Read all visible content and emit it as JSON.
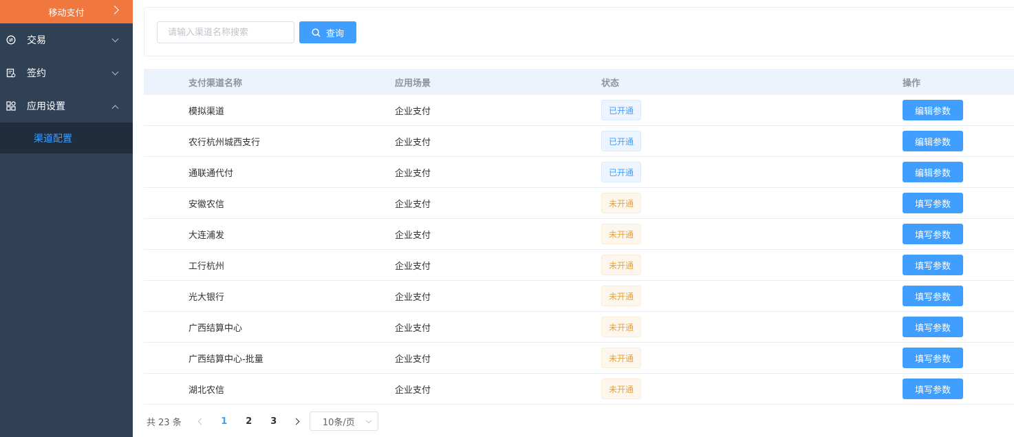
{
  "sidebar": {
    "top_label": "移动支付",
    "menu": [
      {
        "label": "交易",
        "icon": "transaction-icon",
        "expanded": false
      },
      {
        "label": "签约",
        "icon": "contract-icon",
        "expanded": false
      },
      {
        "label": "应用设置",
        "icon": "apps-grid-icon",
        "expanded": true
      }
    ],
    "submenu_active": "渠道配置"
  },
  "search": {
    "placeholder": "请输入渠道名称搜索",
    "value": "",
    "button_label": "查询"
  },
  "table": {
    "columns": [
      "支付渠道名称",
      "应用场景",
      "状态",
      "操作"
    ],
    "rows": [
      {
        "name": "模拟渠道",
        "scene": "企业支付",
        "status": "已开通",
        "status_type": "on",
        "action": "编辑参数"
      },
      {
        "name": "农行杭州城西支行",
        "scene": "企业支付",
        "status": "已开通",
        "status_type": "on",
        "action": "编辑参数"
      },
      {
        "name": "通联通代付",
        "scene": "企业支付",
        "status": "已开通",
        "status_type": "on",
        "action": "编辑参数"
      },
      {
        "name": "安徽农信",
        "scene": "企业支付",
        "status": "未开通",
        "status_type": "off",
        "action": "填写参数"
      },
      {
        "name": "大连浦发",
        "scene": "企业支付",
        "status": "未开通",
        "status_type": "off",
        "action": "填写参数"
      },
      {
        "name": "工行杭州",
        "scene": "企业支付",
        "status": "未开通",
        "status_type": "off",
        "action": "填写参数"
      },
      {
        "name": "光大银行",
        "scene": "企业支付",
        "status": "未开通",
        "status_type": "off",
        "action": "填写参数"
      },
      {
        "name": "广西结算中心",
        "scene": "企业支付",
        "status": "未开通",
        "status_type": "off",
        "action": "填写参数"
      },
      {
        "name": "广西结算中心-批量",
        "scene": "企业支付",
        "status": "未开通",
        "status_type": "off",
        "action": "填写参数"
      },
      {
        "name": "湖北农信",
        "scene": "企业支付",
        "status": "未开通",
        "status_type": "off",
        "action": "填写参数"
      }
    ]
  },
  "pagination": {
    "total_text": "共 23 条",
    "pages": [
      "1",
      "2",
      "3"
    ],
    "current_page": "1",
    "page_size": "10条/页"
  },
  "colors": {
    "sidebar_bg": "#304156",
    "sidebar_top_bg": "#f0783f",
    "submenu_bg": "#1f2d3d",
    "primary": "#409eff",
    "status_on": "#409eff",
    "status_off": "#e6a23c",
    "table_header_bg": "#edf3fd"
  }
}
